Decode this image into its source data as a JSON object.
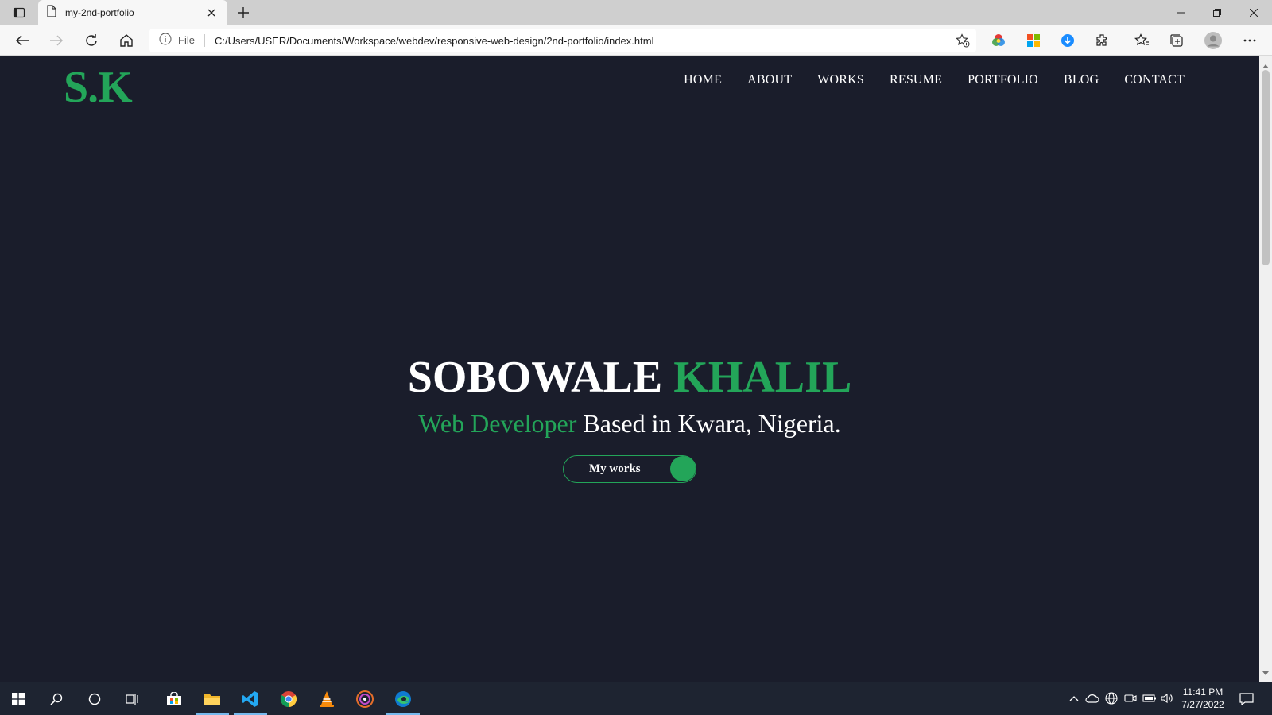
{
  "browser": {
    "tab": {
      "title": "my-2nd-portfolio"
    },
    "address": {
      "scheme_label": "File",
      "url": "C:/Users/USER/Documents/Workspace/webdev/responsive-web-design/2nd-portfolio/index.html"
    }
  },
  "site": {
    "logo": "S.K",
    "nav": [
      "HOME",
      "ABOUT",
      "WORKS",
      "RESUME",
      "PORTFOLIO",
      "BLOG",
      "CONTACT"
    ],
    "hero": {
      "first_name": "SOBOWALE",
      "last_name": "KHALIL",
      "role": "Web Developer",
      "location": "Based in Kwara, Nigeria.",
      "cta": "My works"
    }
  },
  "taskbar": {
    "time": "11:41 PM",
    "date": "7/27/2022"
  },
  "colors": {
    "page_bg": "#1a1d2b",
    "accent": "#23a559",
    "text": "#ffffff"
  }
}
